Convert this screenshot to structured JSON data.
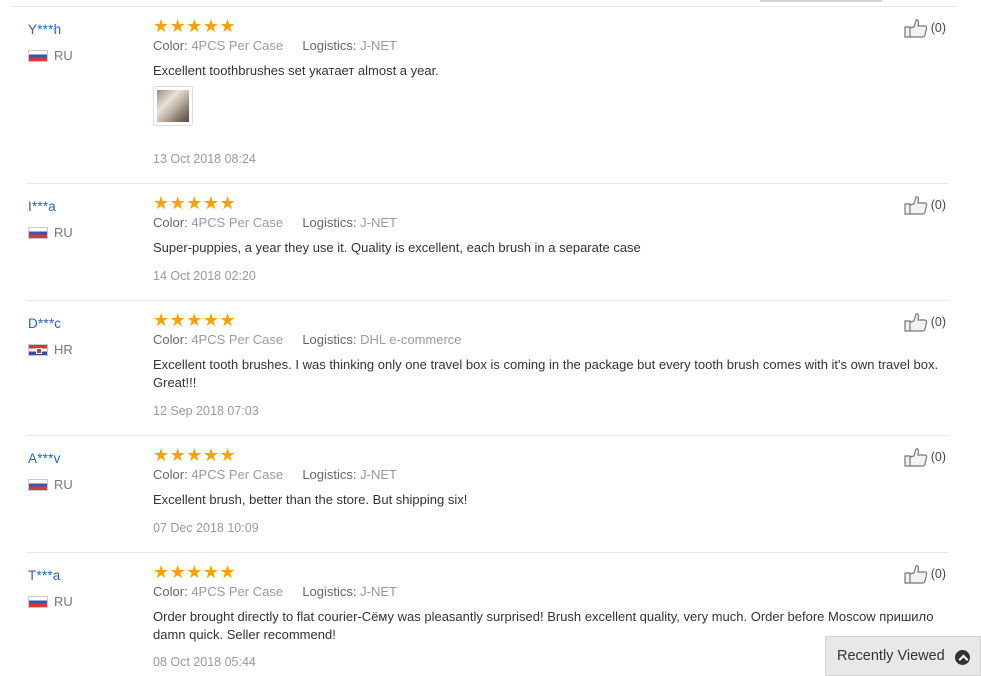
{
  "reviews": [
    {
      "user": "Y***h",
      "country": "RU",
      "flag": "ru",
      "rating": 5,
      "color_label": "Color:",
      "color": "4PCS Per Case",
      "logistics_label": "Logistics:",
      "logistics": "J-NET",
      "text": "Excellent toothbrushes set укатает almost a year.",
      "has_photo": true,
      "date": "13 Oct 2018 08:24",
      "helpful": "(0)"
    },
    {
      "user": "I***a",
      "country": "RU",
      "flag": "ru",
      "rating": 5,
      "color_label": "Color:",
      "color": "4PCS Per Case",
      "logistics_label": "Logistics:",
      "logistics": "J-NET",
      "text": "Super-puppies, a year they use it. Quality is excellent, each brush in a separate case",
      "has_photo": false,
      "date": "14 Oct 2018 02:20",
      "helpful": "(0)"
    },
    {
      "user": "D***c",
      "country": "HR",
      "flag": "hr",
      "rating": 5,
      "color_label": "Color:",
      "color": "4PCS Per Case",
      "logistics_label": "Logistics:",
      "logistics": "DHL e-commerce",
      "text": "Excellent tooth brushes. I was thinking only one travel box is coming in the package but every tooth brush comes with it's own travel box. Great!!!",
      "has_photo": false,
      "date": "12 Sep 2018 07:03",
      "helpful": "(0)"
    },
    {
      "user": "A***v",
      "country": "RU",
      "flag": "ru",
      "rating": 5,
      "color_label": "Color:",
      "color": "4PCS Per Case",
      "logistics_label": "Logistics:",
      "logistics": "J-NET",
      "text": "Excellent brush, better than the store. But shipping six!",
      "has_photo": false,
      "date": "07 Dec 2018 10:09",
      "helpful": "(0)"
    },
    {
      "user": "T***a",
      "country": "RU",
      "flag": "ru",
      "rating": 5,
      "color_label": "Color:",
      "color": "4PCS Per Case",
      "logistics_label": "Logistics:",
      "logistics": "J-NET",
      "text": "Order brought directly to flat courier-Сёму was pleasantly surprised! Brush excellent quality, very much. Order before Moscow пришило damn quick. Seller recommend!",
      "has_photo": false,
      "date": "08 Oct 2018 05:44",
      "helpful": "(0)"
    }
  ],
  "stars_text": "★★★★★",
  "recently_viewed": "Recently Viewed",
  "colors": {
    "username": "#2466b6",
    "stars": "#f6a200",
    "muted": "#9a9a9a"
  },
  "icons": {
    "helpful": "thumbs-up-icon",
    "photo": "review-photo-thumbnail",
    "recently_viewed": "chevron-up-circle-icon"
  }
}
